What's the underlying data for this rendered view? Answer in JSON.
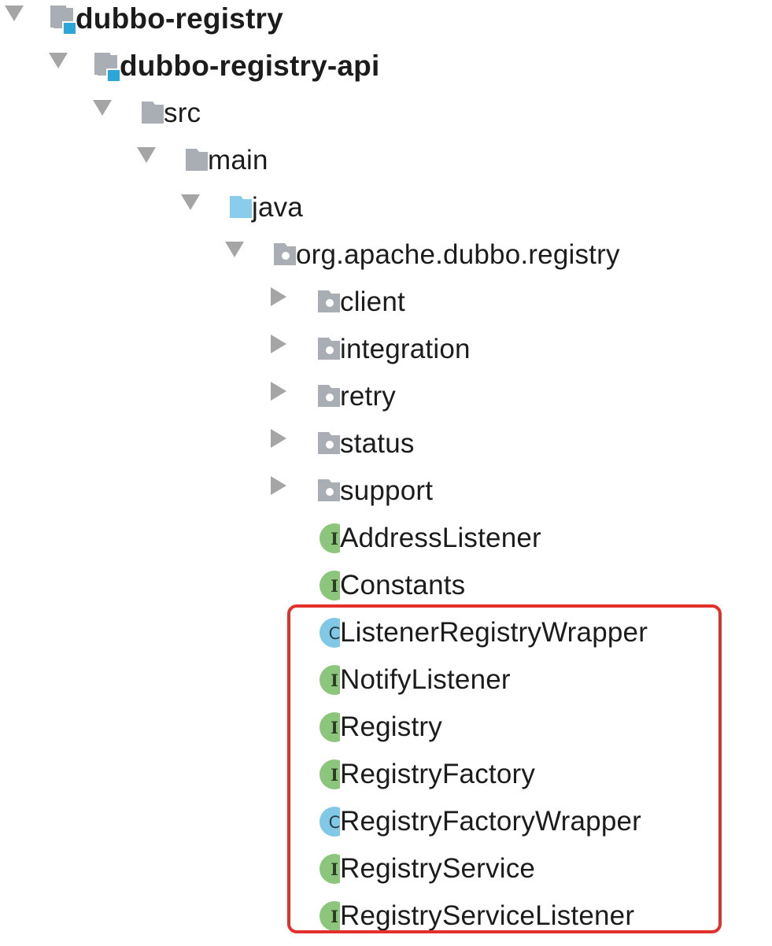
{
  "tree": {
    "nodes": [
      {
        "label": "dubbo-registry",
        "icon": "module-folder-icon",
        "expanded": true,
        "bold": true
      },
      {
        "label": "dubbo-registry-api",
        "icon": "module-folder-icon",
        "expanded": true,
        "bold": true
      },
      {
        "label": "src",
        "icon": "folder-icon",
        "expanded": true
      },
      {
        "label": "main",
        "icon": "folder-icon",
        "expanded": true
      },
      {
        "label": "java",
        "icon": "source-root-folder-icon",
        "expanded": true
      },
      {
        "label": "org.apache.dubbo.registry",
        "icon": "package-icon",
        "expanded": true
      },
      {
        "label": "client",
        "icon": "package-icon",
        "expanded": false
      },
      {
        "label": "integration",
        "icon": "package-icon",
        "expanded": false
      },
      {
        "label": "retry",
        "icon": "package-icon",
        "expanded": false
      },
      {
        "label": "status",
        "icon": "package-icon",
        "expanded": false
      },
      {
        "label": "support",
        "icon": "package-icon",
        "expanded": false
      },
      {
        "label": "AddressListener",
        "icon": "interface-icon",
        "badge": "I"
      },
      {
        "label": "Constants",
        "icon": "interface-icon",
        "badge": "I"
      },
      {
        "label": "ListenerRegistryWrapper",
        "icon": "class-icon",
        "badge": "C"
      },
      {
        "label": "NotifyListener",
        "icon": "interface-icon",
        "badge": "I"
      },
      {
        "label": "Registry",
        "icon": "interface-icon",
        "badge": "I"
      },
      {
        "label": "RegistryFactory",
        "icon": "interface-icon",
        "badge": "I"
      },
      {
        "label": "RegistryFactoryWrapper",
        "icon": "class-icon",
        "badge": "C"
      },
      {
        "label": "RegistryService",
        "icon": "interface-icon",
        "badge": "I"
      },
      {
        "label": "RegistryServiceListener",
        "icon": "interface-icon",
        "badge": "I"
      }
    ]
  },
  "colors": {
    "folder_gray": "#a8aeb3",
    "source_root_blue": "#89cdea",
    "module_accent": "#2aa6d9",
    "interface_green": "#8bc67c",
    "class_blue": "#80c8e6",
    "highlight_red": "#e3302b",
    "arrow_gray": "#a5a5a5"
  }
}
